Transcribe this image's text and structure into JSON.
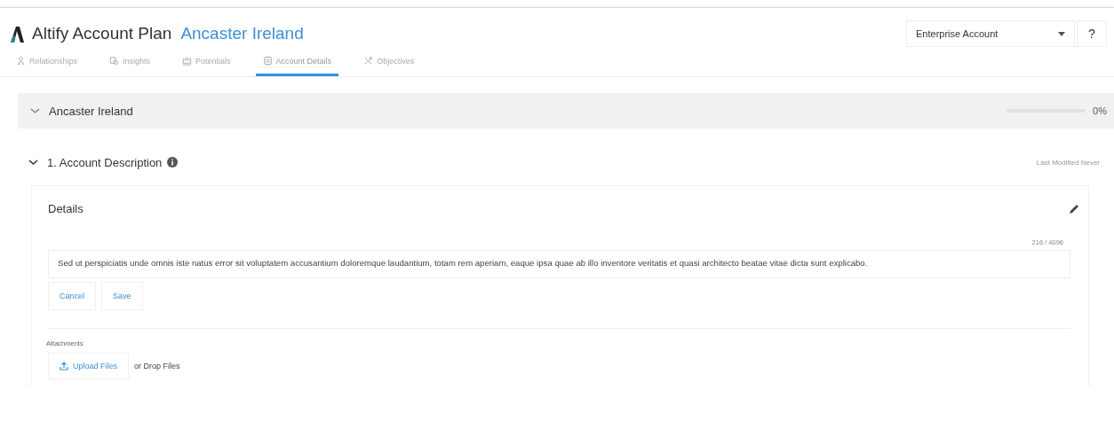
{
  "header": {
    "app_title": "Altify Account Plan",
    "account_name": "Ancaster Ireland",
    "plan_type": {
      "value": "Enterprise Account"
    },
    "help": "?"
  },
  "tabs": [
    {
      "label": "Relationships",
      "selected": false
    },
    {
      "label": "Insights",
      "selected": false
    },
    {
      "label": "Potentials",
      "selected": false
    },
    {
      "label": "Account Details",
      "selected": true
    },
    {
      "label": "Objectives",
      "selected": false
    }
  ],
  "section": {
    "title": "Ancaster Ireland",
    "expanded": true,
    "level": 0,
    "reading": "0%"
  },
  "subsection": {
    "title": "1. Account Description",
    "expanded": true,
    "last_modified": "Last Modified Never"
  },
  "card": {
    "title": "Details",
    "counter": "216 / 4096",
    "text": "Sed ut perspiciatis unde omnis iste natus error sit voluptatem accusantium doloremque laudantium, totam rem aperiam, eaque ipsa quae ab illo inventore veritatis et quasi architecto beatae vitae dicta sunt explicabo.",
    "buttons": [
      "Cancel",
      "Save"
    ],
    "attachments_label": "Attachments",
    "upload": "Upload Files",
    "drop": "or Drop Files"
  }
}
